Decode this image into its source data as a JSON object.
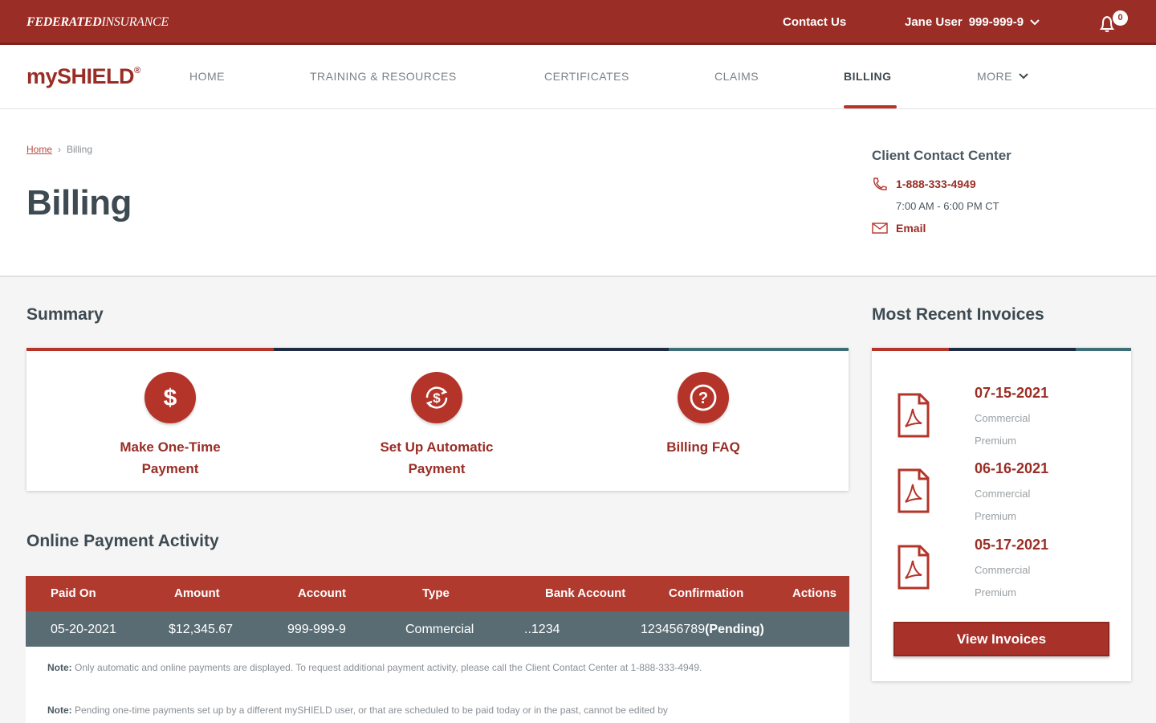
{
  "topbar": {
    "logo_federated": "FEDERATED",
    "logo_insurance": "INSURANCE",
    "contact_us": "Contact Us",
    "user_name": "Jane User",
    "user_account": "999-999-9",
    "notification_count": "0"
  },
  "nav": {
    "brand": "mySHIELD",
    "brand_mark": "®",
    "items": [
      {
        "label": "HOME"
      },
      {
        "label": "TRAINING & RESOURCES"
      },
      {
        "label": "CERTIFICATES"
      },
      {
        "label": "CLAIMS"
      },
      {
        "label": "BILLING",
        "active": true
      },
      {
        "label": "MORE"
      }
    ]
  },
  "breadcrumb": {
    "home": "Home",
    "separator": "›",
    "current": "Billing"
  },
  "page_title": "Billing",
  "contact_center": {
    "title": "Client Contact Center",
    "phone": "1-888-333-4949",
    "hours": "7:00 AM - 6:00 PM CT",
    "email": "Email"
  },
  "summary": {
    "title": "Summary",
    "actions": [
      {
        "line1": "Make One-Time",
        "line2": "Payment",
        "icon": "dollar-icon"
      },
      {
        "line1": "Set Up Automatic",
        "line2": "Payment",
        "icon": "auto-pay-icon"
      },
      {
        "line1": "Billing FAQ",
        "line2": "",
        "icon": "question-icon"
      }
    ]
  },
  "activity": {
    "title": "Online Payment Activity",
    "columns": [
      "Paid On",
      "Amount",
      "Account",
      "Type",
      "Bank Account",
      "Confirmation",
      "Actions"
    ],
    "rows": [
      {
        "paid_on": "05-20-2021",
        "amount": "$12,345.67",
        "account": "999-999-9",
        "type": "Commercial",
        "bank": "..1234",
        "confirmation": "123456789",
        "status": "(Pending)"
      }
    ],
    "note1_label": "Note:",
    "note1_text": " Only automatic and online payments are displayed. To request additional payment activity, please call the Client Contact Center at 1-888-333-4949.",
    "note2_label": "Note:",
    "note2_text": " Pending one-time payments set up by a different mySHIELD user, or that are scheduled to be paid today or in the past, cannot be edited by"
  },
  "invoices": {
    "title": "Most Recent Invoices",
    "items": [
      {
        "date": "07-15-2021",
        "desc": "Commercial Premium"
      },
      {
        "date": "06-16-2021",
        "desc": "Commercial Premium"
      },
      {
        "date": "05-17-2021",
        "desc": "Commercial Premium"
      }
    ],
    "button": "View Invoices"
  },
  "colors": {
    "brand_red": "#9a2d25",
    "slate": "#596c74",
    "navy": "#1f2a44",
    "teal": "#3e6e78"
  }
}
